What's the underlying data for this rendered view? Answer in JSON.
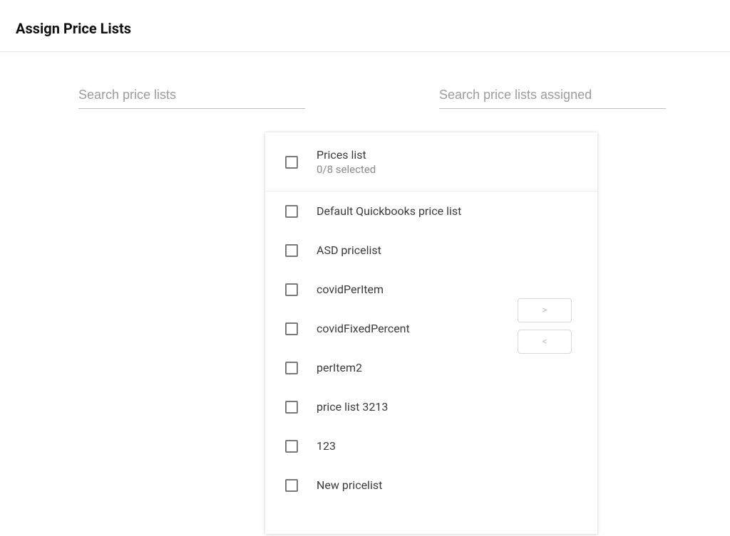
{
  "title": "Assign Price Lists",
  "left": {
    "search_placeholder": "Search price lists",
    "list_header_title": "Prices list",
    "list_header_sub": "0/8 selected",
    "items": [
      "Default Quickbooks price list",
      "ASD pricelist",
      "covidPerItem",
      "covidFixedPercent",
      "perItem2",
      "price list 3213",
      "123",
      "New pricelist"
    ]
  },
  "right": {
    "search_placeholder": "Search price lists assigned"
  },
  "buttons": {
    "move_right": ">",
    "move_left": "<"
  }
}
